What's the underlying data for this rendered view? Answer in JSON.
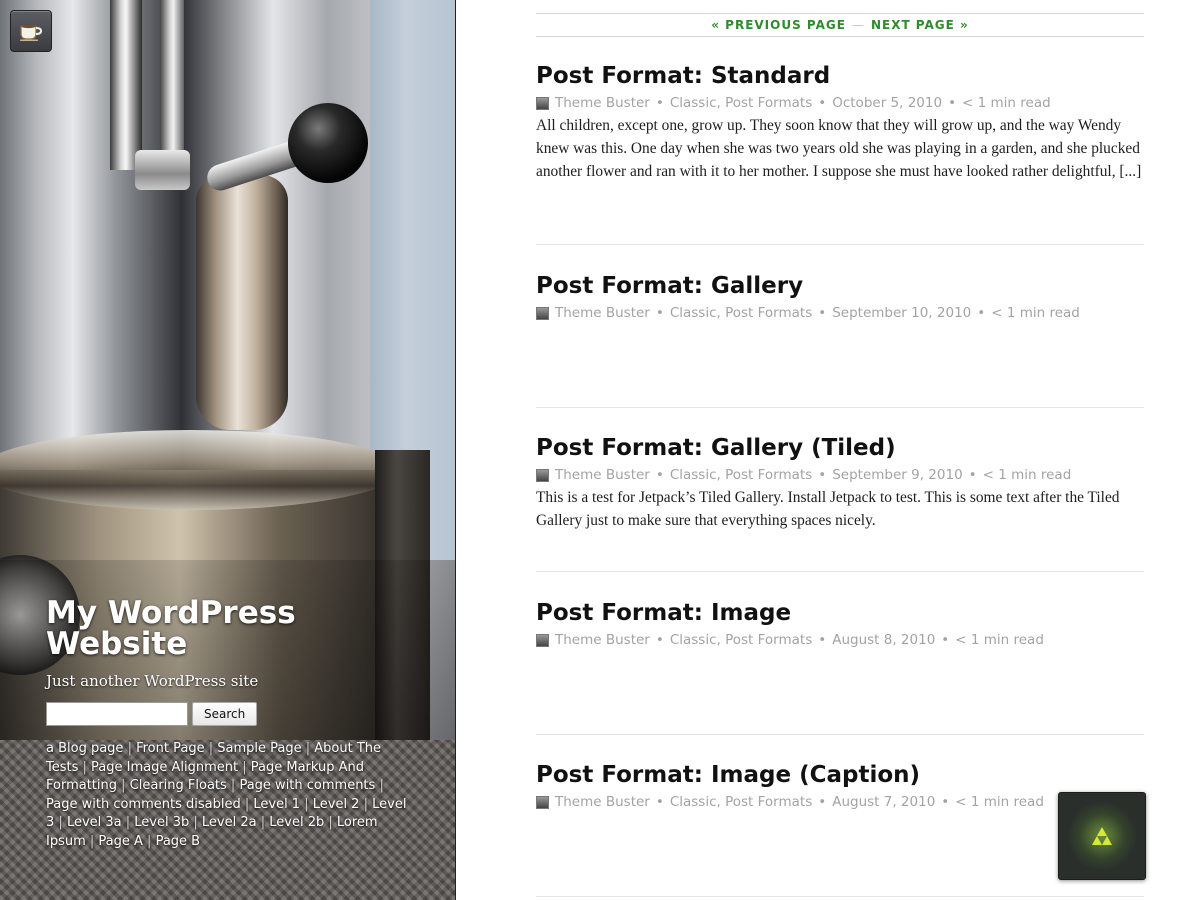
{
  "site": {
    "title": "My WordPress Website",
    "description": "Just another WordPress site",
    "search_placeholder": "",
    "search_button": "Search"
  },
  "page_links": [
    {
      "label": "a Blog page"
    },
    {
      "label": "Front Page"
    },
    {
      "label": "Sample Page"
    },
    {
      "label": "About The Tests"
    },
    {
      "label": "Page Image Alignment"
    },
    {
      "label": "Page Markup And Formatting"
    },
    {
      "label": "Clearing Floats"
    },
    {
      "label": "Page with comments"
    },
    {
      "label": "Page with comments disabled"
    },
    {
      "label": "Level 1"
    },
    {
      "label": "Level 2"
    },
    {
      "label": "Level 3"
    },
    {
      "label": "Level 3a"
    },
    {
      "label": "Level 3b"
    },
    {
      "label": "Level 2a"
    },
    {
      "label": "Level 2b"
    },
    {
      "label": "Lorem Ipsum"
    },
    {
      "label": "Page A"
    },
    {
      "label": "Page B"
    }
  ],
  "pager": {
    "previous": "« PREVIOUS PAGE",
    "next": "NEXT PAGE »"
  },
  "posts": [
    {
      "title": "Post Format: Standard",
      "author": "Theme Buster",
      "categories": "Classic, Post Formats",
      "date": "October 5, 2010",
      "read_time": "< 1 min read",
      "excerpt": "All children, except one, grow up. They soon know that they will grow up, and the way Wendy knew was this. One day when she was two years old she was playing in a garden, and she plucked another flower and ran with it to her mother. I suppose she must have looked rather delightful, [...]"
    },
    {
      "title": "Post Format: Gallery",
      "author": "Theme Buster",
      "categories": "Classic, Post Formats",
      "date": "September 10, 2010",
      "read_time": "< 1 min read",
      "excerpt": ""
    },
    {
      "title": "Post Format: Gallery (Tiled)",
      "author": "Theme Buster",
      "categories": "Classic, Post Formats",
      "date": "September 9, 2010",
      "read_time": "< 1 min read",
      "excerpt": "This is a test for Jetpack’s Tiled Gallery. Install Jetpack to test. This is some text after the Tiled Gallery just to make sure that everything spaces nicely."
    },
    {
      "title": "Post Format: Image",
      "author": "Theme Buster",
      "categories": "Classic, Post Formats",
      "date": "August 8, 2010",
      "read_time": "< 1 min read",
      "excerpt": ""
    },
    {
      "title": "Post Format: Image (Caption)",
      "author": "Theme Buster",
      "categories": "Classic, Post Formats",
      "date": "August 7, 2010",
      "read_time": "< 1 min read",
      "excerpt": ""
    }
  ],
  "meta_separator": "•",
  "icons": {
    "site_icon": "coffee-cup-icon",
    "author_avatar": "avatar-icon",
    "widget": "triforce-icon"
  },
  "colors": {
    "link_green": "#2e8b2e",
    "meta_gray": "#a3a3a3",
    "title_black": "#111111",
    "widget_bg": "#2b2f2c",
    "widget_accent": "#c8e03a"
  }
}
